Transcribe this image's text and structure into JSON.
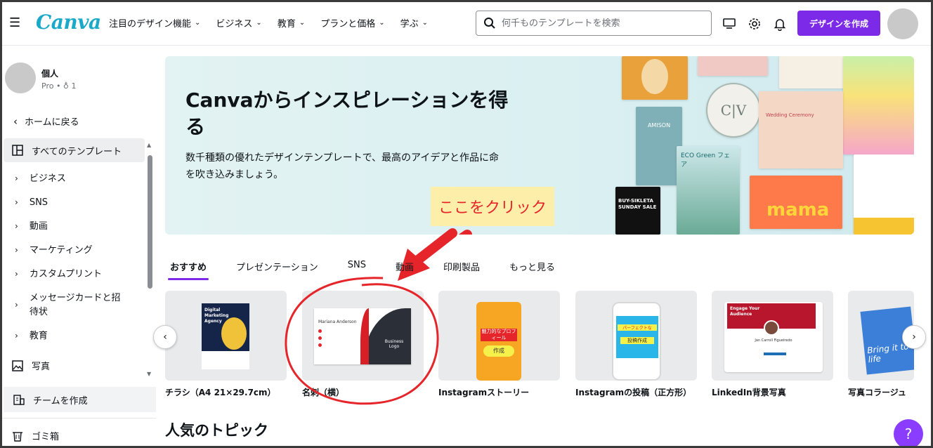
{
  "header": {
    "logo": "Canva",
    "nav": [
      "注目のデザイン機能",
      "ビジネス",
      "教育",
      "プランと価格",
      "学ぶ"
    ],
    "search_placeholder": "何千ものテンプレートを検索",
    "create_label": "デザインを作成"
  },
  "sidebar": {
    "user_name": "個人",
    "user_sub": "Pro • ♁ 1",
    "back_label": "ホームに戻る",
    "all_templates": "すべてのテンプレート",
    "categories": [
      "ビジネス",
      "SNS",
      "動画",
      "マーケティング",
      "カスタムプリント",
      "メッセージカードと招待状",
      "教育"
    ],
    "photo_label": "写真",
    "team_label": "チームを作成",
    "trash_label": "ゴミ箱"
  },
  "hero": {
    "title": "Canvaからインスピレーションを得る",
    "description": "数千種類の優れたデザインテンプレートで、最高のアイデアと作品に命を吹き込みましょう。",
    "callout": "ここをクリック",
    "tile_texts": {
      "cv": "C|V",
      "wedding": "Wedding Ceremony",
      "eco": "ECO Green フェア",
      "sale": "BUY-SIKLETA SUNDAY SALE",
      "mama": "mama",
      "amison": "AMISON"
    }
  },
  "tabs": [
    "おすすめ",
    "プレゼンテーション",
    "SNS",
    "動画",
    "印刷製品",
    "もっと見る"
  ],
  "active_tab": 0,
  "cards": [
    {
      "label": "チラシ（A4 21×29.7cm）",
      "thumb_text": "Digital Marketing Agency"
    },
    {
      "label": "名刺（横）",
      "thumb_text": "Mariana Anderson",
      "thumb_text2": "Business Logo"
    },
    {
      "label": "Instagramストーリー",
      "thumb_text": "魅力的なプロフィール",
      "thumb_text2": "作成"
    },
    {
      "label": "Instagramの投稿（正方形）",
      "thumb_text": "パーフェクトな",
      "thumb_text2": "投稿作成"
    },
    {
      "label": "LinkedIn背景写真",
      "thumb_text": "Engage Your Audience",
      "thumb_text2": "Jan Carroll Figueiredo"
    },
    {
      "label": "写真コラージュ",
      "thumb_text": "Bring it to life"
    }
  ],
  "popular_title": "人気のトピック",
  "help_label": "?",
  "colors": {
    "brand": "#7d2ae8",
    "accent_red": "#e5252a",
    "logo": "#1aa9c9"
  }
}
